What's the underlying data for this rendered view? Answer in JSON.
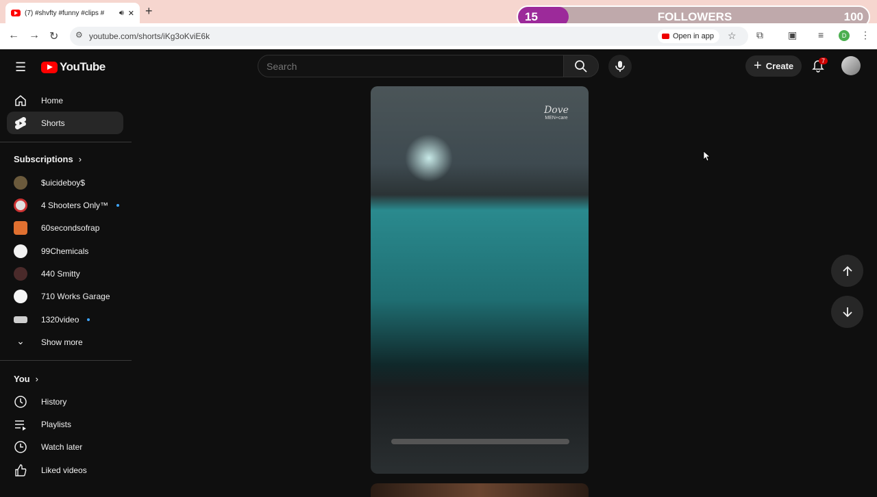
{
  "browser": {
    "tab_title": "(7) #shvfty #funny #clips #",
    "url": "youtube.com/shorts/iKg3oKviE6k",
    "open_in_app": "Open in app",
    "profile_letter": "D"
  },
  "overlay": {
    "current": "15",
    "label": "FOLLOWERS",
    "goal": "100",
    "progress_fraction": 0.15,
    "fill_color": "#9c2a9a"
  },
  "header": {
    "logo_text": "YouTube",
    "search_placeholder": "Search",
    "create_label": "Create",
    "notification_count": "7"
  },
  "sidebar": {
    "main": [
      {
        "label": "Home",
        "icon": "home-icon"
      },
      {
        "label": "Shorts",
        "icon": "shorts-icon",
        "selected": true
      }
    ],
    "subscriptions_title": "Subscriptions",
    "subscriptions": [
      {
        "label": "$uicideboy$",
        "color": "#6b5a3c",
        "new": false
      },
      {
        "label": "4 Shooters Only™",
        "color": "#e0e0e0",
        "new": true
      },
      {
        "label": "60secondsofrap",
        "color": "#e07030",
        "new": false
      },
      {
        "label": "99Chemicals",
        "color": "#f2f2f2",
        "new": false
      },
      {
        "label": "440 Smitty",
        "color": "#4a2a2a",
        "new": false
      },
      {
        "label": "710 Works Garage",
        "color": "#f5f5f5",
        "new": false
      },
      {
        "label": "1320video",
        "color": "#cfcfcf",
        "new": true
      }
    ],
    "show_more": "Show more",
    "you_title": "You",
    "you": [
      {
        "label": "History",
        "icon": "history-icon"
      },
      {
        "label": "Playlists",
        "icon": "playlists-icon"
      },
      {
        "label": "Watch later",
        "icon": "watch-later-icon"
      },
      {
        "label": "Liked videos",
        "icon": "like-icon"
      }
    ]
  },
  "video": {
    "brand_name": "Dove",
    "brand_sub": "MEN+care"
  }
}
